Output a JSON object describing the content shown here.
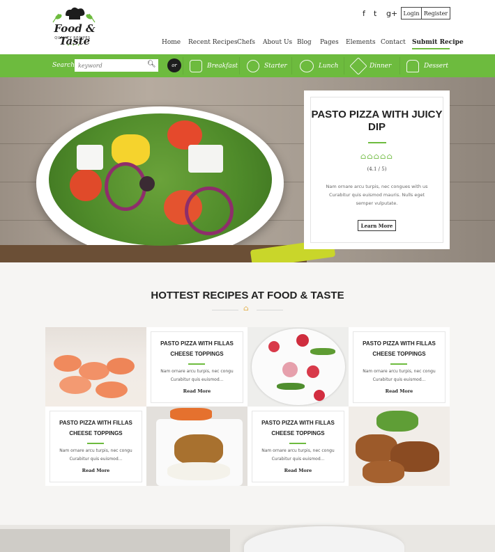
{
  "header": {
    "logo": {
      "title": "Food & Taste",
      "subtitle": "QUALITY RECIPES",
      "dots": "• • •"
    },
    "social": [
      "f",
      "t",
      "g+"
    ],
    "login_label": "Login",
    "register_label": "Register",
    "nav": [
      {
        "label": "Home"
      },
      {
        "label": "Recent Recipes"
      },
      {
        "label": "Chefs"
      },
      {
        "label": "About Us"
      },
      {
        "label": "Blog"
      },
      {
        "label": "Pages"
      },
      {
        "label": "Elements"
      },
      {
        "label": "Contact"
      },
      {
        "label": "Submit Recipe"
      }
    ]
  },
  "search": {
    "label": "Search",
    "placeholder": "keyword",
    "or_label": "or",
    "categories": [
      {
        "label": "Breakfast",
        "icon": "bread-icon"
      },
      {
        "label": "Starter",
        "icon": "grapes-icon"
      },
      {
        "label": "Lunch",
        "icon": "bowl-icon"
      },
      {
        "label": "Dinner",
        "icon": "pizza-icon"
      },
      {
        "label": "Dessert",
        "icon": "cupcake-icon"
      }
    ]
  },
  "hero": {
    "title": "PASTO PIZZA WITH JUICY DIP",
    "rating_icons": "⌂⌂⌂⌂⌂",
    "rating_text": "(4.1 / 5)",
    "description": "Nam ornare arcu turpis, nec congues with us Curabitur quis euismod mauris. Nulls eget semper vulputate.",
    "button_label": "Learn More"
  },
  "hottest": {
    "title": "HOTTEST RECIPES AT FOOD & TASTE",
    "cards": [
      {
        "title": "PASTO PIZZA WITH FILLAS CHEESE TOPPINGS",
        "desc": "Nam ornare arcu turpis, nec congu Curabitur quis euismod...",
        "more": "Read More"
      },
      {
        "title": "PASTO PIZZA WITH FILLAS CHEESE TOPPINGS",
        "desc": "Nam ornare arcu turpis, nec congu Curabitur quis euismod...",
        "more": "Read More"
      },
      {
        "title": "PASTO PIZZA WITH FILLAS CHEESE TOPPINGS",
        "desc": "Nam ornare arcu turpis, nec congu Curabitur quis euismod...",
        "more": "Read More"
      },
      {
        "title": "PASTO PIZZA WITH FILLAS CHEESE TOPPINGS",
        "desc": "Nam ornare arcu turpis, nec congu Curabitur quis euismod...",
        "more": "Read More"
      }
    ]
  },
  "colors": {
    "accent": "#6dbb3e",
    "dark": "#1d1d1d"
  }
}
